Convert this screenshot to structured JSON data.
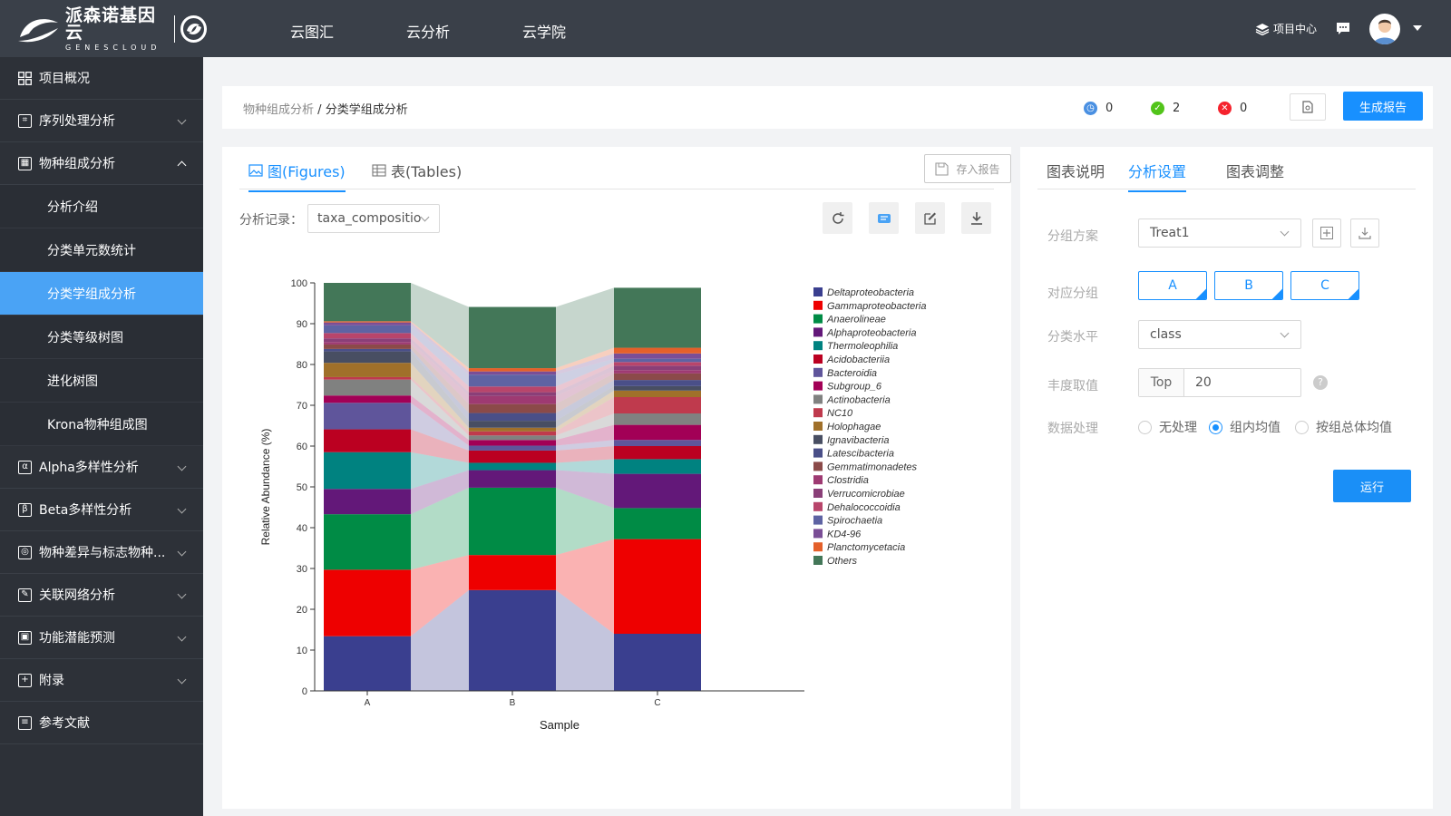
{
  "brand": {
    "name_cn": "派森诺基因云",
    "name_en": "GENESCLOUD"
  },
  "topnav": {
    "items": [
      "云图汇",
      "云分析",
      "云学院"
    ],
    "project_center": "项目中心"
  },
  "sidebar": {
    "items": [
      {
        "label": "项目概况",
        "icon": "grid-icon"
      },
      {
        "label": "序列处理分析",
        "icon": "sequence-icon"
      },
      {
        "label": "物种组成分析",
        "icon": "species-icon",
        "expanded": true,
        "children": [
          "分析介绍",
          "分类单元数统计",
          "分类学组成分析",
          "分类等级树图",
          "进化树图",
          "Krona物种组成图"
        ],
        "active_child": "分类学组成分析"
      },
      {
        "label": "Alpha多样性分析",
        "icon": "alpha-icon",
        "glyph": "α"
      },
      {
        "label": "Beta多样性分析",
        "icon": "beta-icon",
        "glyph": "β"
      },
      {
        "label": "物种差异与标志物种...",
        "icon": "marker-icon"
      },
      {
        "label": "关联网络分析",
        "icon": "network-icon"
      },
      {
        "label": "功能潜能预测",
        "icon": "function-icon"
      },
      {
        "label": "附录",
        "icon": "appendix-icon"
      },
      {
        "label": "参考文献",
        "icon": "book-icon"
      }
    ]
  },
  "breadcrumb": {
    "parent": "物种组成分析",
    "separator": "/",
    "current": "分类学组成分析"
  },
  "status": {
    "pending": "0",
    "success": "2",
    "failed": "0"
  },
  "header": {
    "generate_report": "生成报告"
  },
  "main": {
    "tabs": [
      {
        "label": "图(Figures)"
      },
      {
        "label": "表(Tables)"
      }
    ],
    "save_report": "存入报告",
    "record_label": "分析记录：",
    "record_value": "taxa_compositio"
  },
  "settings": {
    "tabs": [
      "图表说明",
      "分析设置",
      "图表调整"
    ],
    "group_scheme_label": "分组方案",
    "group_scheme_value": "Treat1",
    "groups_label": "对应分组",
    "groups": [
      "A",
      "B",
      "C"
    ],
    "level_label": "分类水平",
    "level_value": "class",
    "abundance_label": "丰度取值",
    "abundance_prefix": "Top",
    "abundance_value": "20",
    "processing_label": "数据处理",
    "processing_options": [
      "无处理",
      "组内均值",
      "按组总体均值"
    ],
    "processing_selected": 1,
    "run": "运行"
  },
  "colors": {
    "accent": "#1890ff",
    "sidebar_bg": "#2d3138",
    "topbar_bg": "#3a4049",
    "active_item": "#4aa3f5"
  },
  "chart_data": {
    "type": "bar",
    "stacked": true,
    "xlabel": "Sample",
    "ylabel": "Relative Abundance (%)",
    "ylim": [
      0,
      100
    ],
    "yticks": [
      0,
      10,
      20,
      30,
      40,
      50,
      60,
      70,
      80,
      90,
      100
    ],
    "categories": [
      "A",
      "B",
      "C"
    ],
    "legend_position": "right",
    "series": [
      {
        "name": "Deltaproteobacteria",
        "color": "#3a3f8f",
        "values": [
          13.4,
          24.7,
          14.0
        ]
      },
      {
        "name": "Gammaproteobacteria",
        "color": "#ee0000",
        "values": [
          16.3,
          8.6,
          23.2
        ]
      },
      {
        "name": "Anaerolineae",
        "color": "#008b45",
        "values": [
          13.6,
          16.5,
          7.6
        ]
      },
      {
        "name": "Alphaproteobacteria",
        "color": "#631879",
        "values": [
          6.2,
          4.3,
          8.4
        ]
      },
      {
        "name": "Thermoleophilia",
        "color": "#008280",
        "values": [
          9.0,
          1.8,
          3.6
        ]
      },
      {
        "name": "Acidobacteriia",
        "color": "#bb0021",
        "values": [
          5.6,
          3.0,
          3.2
        ]
      },
      {
        "name": "Bacteroidia",
        "color": "#5f559b",
        "values": [
          6.5,
          1.2,
          1.5
        ]
      },
      {
        "name": "Subgroup_6",
        "color": "#a20056",
        "values": [
          1.8,
          1.4,
          3.7
        ]
      },
      {
        "name": "Actinobacteria",
        "color": "#808180",
        "values": [
          3.9,
          1.1,
          2.8
        ]
      },
      {
        "name": "NC10",
        "color": "#bf3a4d",
        "values": [
          0.6,
          1.0,
          4.0
        ]
      },
      {
        "name": "Holophagae",
        "color": "#a0702a",
        "values": [
          3.5,
          0.9,
          1.6
        ]
      },
      {
        "name": "Ignavibacteria",
        "color": "#484e62",
        "values": [
          2.8,
          1.7,
          1.1
        ]
      },
      {
        "name": "Latescibacteria",
        "color": "#4a4f88",
        "values": [
          0.6,
          1.9,
          1.5
        ]
      },
      {
        "name": "Gemmatimonadetes",
        "color": "#8b4a49",
        "values": [
          1.1,
          2.2,
          1.6
        ]
      },
      {
        "name": "Clostridia",
        "color": "#9e3a72",
        "values": [
          0.6,
          2.0,
          0.8
        ]
      },
      {
        "name": "Verrucomicrobiae",
        "color": "#8a3f78",
        "values": [
          0.9,
          0.9,
          1.1
        ]
      },
      {
        "name": "Dehalococcoidia",
        "color": "#b8456b",
        "values": [
          1.3,
          1.4,
          0.9
        ]
      },
      {
        "name": "Spirochaetia",
        "color": "#5e63a3",
        "values": [
          1.9,
          2.9,
          0.8
        ]
      },
      {
        "name": "KD4-96",
        "color": "#7a4e96",
        "values": [
          0.7,
          0.8,
          1.3
        ]
      },
      {
        "name": "Planctomycetacia",
        "color": "#e4602a",
        "values": [
          0.3,
          0.8,
          1.4
        ]
      },
      {
        "name": "Others",
        "color": "#437758",
        "values": [
          9.4,
          15.0,
          14.7
        ]
      }
    ]
  }
}
